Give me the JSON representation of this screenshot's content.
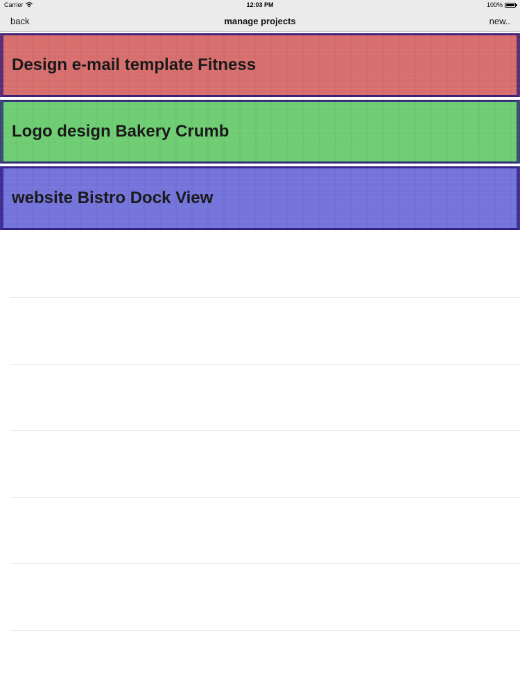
{
  "status_bar": {
    "carrier": "Carrier",
    "time": "12:03 PM",
    "battery": "100%",
    "wifi_icon": "wifi-icon",
    "battery_icon": "battery-icon"
  },
  "nav_bar": {
    "back_label": "back",
    "title": "manage projects",
    "new_label": "new.."
  },
  "projects": [
    {
      "label": "Design e-mail template Fitness",
      "color": "#d76f6f"
    },
    {
      "label": "Logo design Bakery Crumb",
      "color": "#6fcd73"
    },
    {
      "label": "website Bistro Dock View",
      "color": "#7474db"
    }
  ],
  "colors": {
    "nav_background": "#ebebeb",
    "separator": "#e4e4e4"
  }
}
